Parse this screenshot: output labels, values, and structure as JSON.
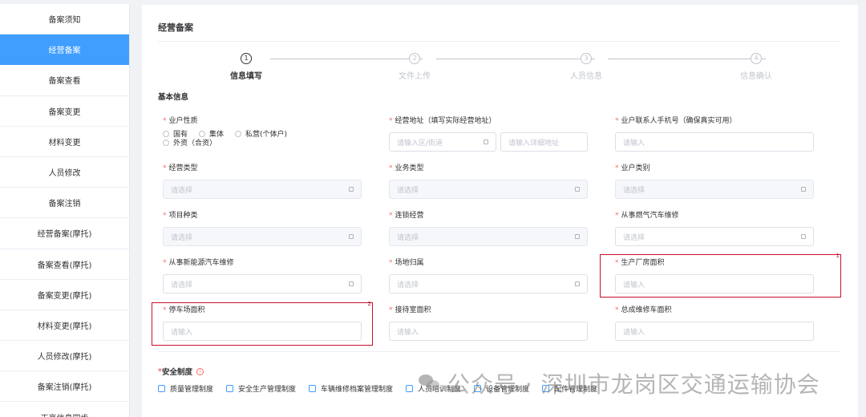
{
  "sidebar": {
    "items": [
      {
        "label": "备案须知",
        "active": false
      },
      {
        "label": "经营备案",
        "active": true
      },
      {
        "label": "备案查看",
        "active": false
      },
      {
        "label": "备案变更",
        "active": false
      },
      {
        "label": "材料变更",
        "active": false
      },
      {
        "label": "人员修改",
        "active": false
      },
      {
        "label": "备案注销",
        "active": false
      },
      {
        "label": "经营备案(摩托)",
        "active": false
      },
      {
        "label": "备案查看(摩托)",
        "active": false
      },
      {
        "label": "备案变更(摩托)",
        "active": false
      },
      {
        "label": "材料变更(摩托)",
        "active": false
      },
      {
        "label": "人员修改(摩托)",
        "active": false
      },
      {
        "label": "备案注销(摩托)",
        "active": false
      },
      {
        "label": "王商信息同步",
        "active": false
      }
    ]
  },
  "page": {
    "title": "经营备案",
    "section_basic": "基本信息"
  },
  "steps": [
    {
      "num": "1",
      "label": "信息填写",
      "active": true
    },
    {
      "num": "2",
      "label": "文件上传",
      "active": false
    },
    {
      "num": "3",
      "label": "人员信息",
      "active": false
    },
    {
      "num": "4",
      "label": "信息确认",
      "active": false
    }
  ],
  "fields": {
    "business_nature": {
      "label": "业户性质",
      "options": [
        "国有",
        "集体",
        "私营(个体户)",
        "外资（合资）"
      ]
    },
    "business_address": {
      "label": "经营地址（填写实际经营地址）",
      "district_placeholder": "请输入区/街道",
      "detail_placeholder": "请输入详细地址"
    },
    "contact_phone": {
      "label": "业户联系人手机号（确保真实可用）",
      "placeholder": "请输入"
    },
    "business_type": {
      "label": "经营类型",
      "placeholder": "请选择"
    },
    "service_type": {
      "label": "业务类型",
      "placeholder": "请选择"
    },
    "operator_category": {
      "label": "业户类别",
      "placeholder": "请选择"
    },
    "project_type": {
      "label": "项目种类",
      "placeholder": "请选择"
    },
    "chain_operation": {
      "label": "连锁经营",
      "placeholder": "请选择"
    },
    "gas_vehicle_repair": {
      "label": "从事燃气汽车维修",
      "placeholder": "请选择"
    },
    "new_energy_repair": {
      "label": "从事新能源汽车维修",
      "placeholder": "请选择"
    },
    "site_ownership": {
      "label": "场地归属",
      "placeholder": "请选择"
    },
    "factory_area": {
      "label": "生产厂房面积",
      "placeholder": "请输入"
    },
    "parking_area": {
      "label": "停车场面积",
      "placeholder": "请输入"
    },
    "reception_area": {
      "label": "接待室面积",
      "placeholder": "请输入"
    },
    "assembly_area": {
      "label": "总成维修车面积",
      "placeholder": "请输入"
    }
  },
  "annotations": {
    "box1": "1",
    "box2": "2"
  },
  "safety": {
    "title_req": "*",
    "title": "安全制度",
    "info": "i",
    "items": [
      "质量管理制度",
      "安全生产管理制度",
      "车辆维修档案管理制度",
      "人员培训制度",
      "设备管理制度",
      "配件管理制度"
    ]
  },
  "watermark": {
    "text": "公众号 · 深圳市龙岗区交通运输协会"
  }
}
